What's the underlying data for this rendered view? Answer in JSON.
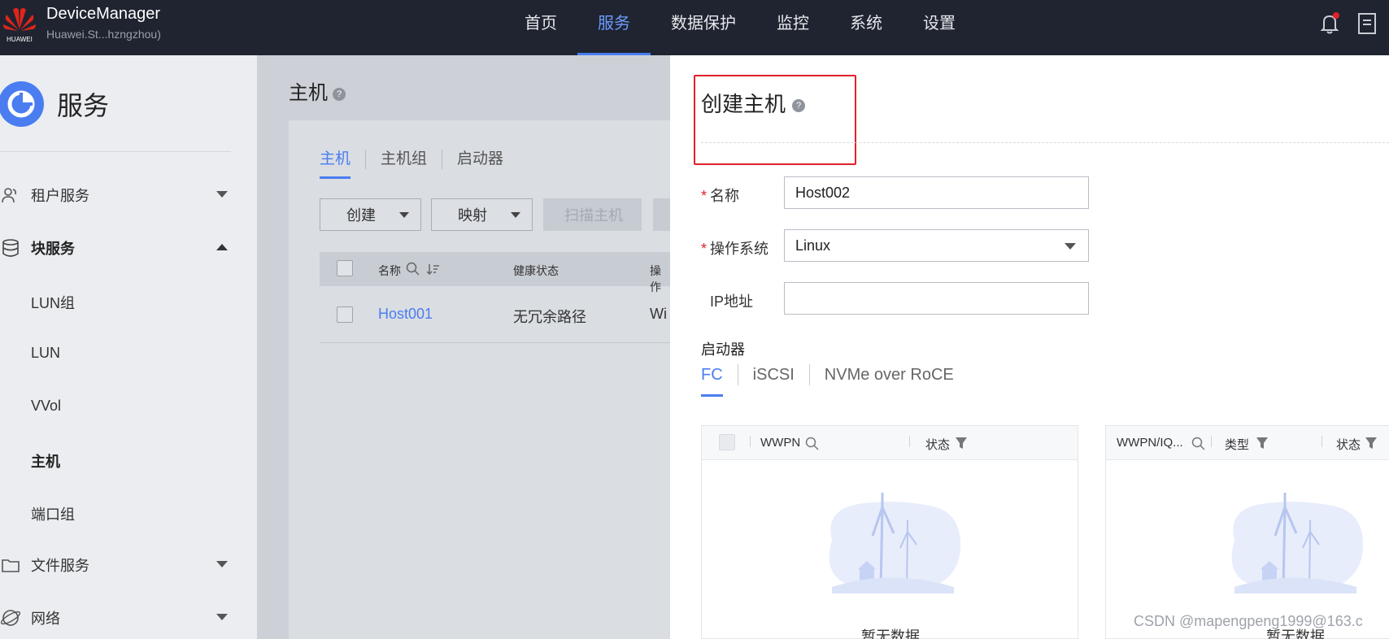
{
  "topbar": {
    "logo_text": "HUAWEI",
    "title": "DeviceManager",
    "subtitle": "Huawei.St...hzngzhou)",
    "nav": [
      "首页",
      "服务",
      "数据保护",
      "监控",
      "系统",
      "设置"
    ],
    "nav_active": "服务",
    "bell_icon": "bell-icon",
    "doc_icon": "document-icon",
    "accent": "#4a7df0"
  },
  "sidebar": {
    "title": "服务",
    "items": [
      {
        "label": "租户服务",
        "icon": "users-icon",
        "expanded": false
      },
      {
        "label": "块服务",
        "icon": "database-icon",
        "expanded": true
      },
      {
        "label": "文件服务",
        "icon": "folder-icon",
        "expanded": false
      },
      {
        "label": "网络",
        "icon": "globe-icon",
        "expanded": false
      }
    ],
    "sub_items": [
      "LUN组",
      "LUN",
      "VVol",
      "主机",
      "端口组"
    ],
    "sub_active": "主机"
  },
  "main": {
    "title": "主机",
    "tabs": [
      "主机",
      "主机组",
      "启动器"
    ],
    "tab_active": "主机",
    "buttons": {
      "create": "创建",
      "map": "映射",
      "scan": "扫描主机"
    },
    "table": {
      "columns": [
        "名称",
        "健康状态",
        "操作"
      ],
      "rows": [
        {
          "name": "Host001",
          "health": "无冗余路径",
          "os": "Wi"
        }
      ]
    }
  },
  "drawer": {
    "title": "创建主机",
    "name_label": "名称",
    "name_value": "Host002",
    "os_label": "操作系统",
    "os_value": "Linux",
    "ip_label": "IP地址",
    "ip_value": "",
    "initiator_label": "启动器",
    "initiator_tabs": [
      "FC",
      "iSCSI",
      "NVMe over RoCE"
    ],
    "initiator_tab_active": "FC",
    "left_panel": {
      "columns": [
        "WWPN",
        "状态"
      ],
      "empty_text": "暂无数据"
    },
    "right_panel": {
      "columns": [
        "WWPN/IQ...",
        "类型",
        "状态"
      ],
      "empty_text": "暂无数据"
    },
    "highlight_color": "#e0202a"
  },
  "watermark": "CSDN @mapengpeng1999@163.c"
}
